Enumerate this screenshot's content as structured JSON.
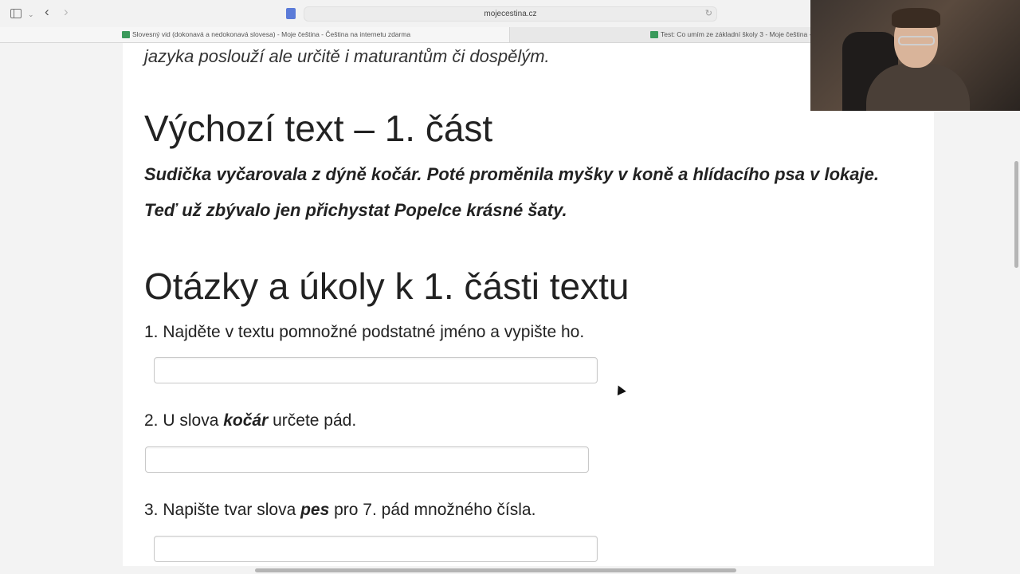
{
  "browser": {
    "url": "mojecestina.cz",
    "tabs": [
      {
        "title": "Slovesný vid (dokonavá a nedokonavá slovesa) - Moje čeština - Čeština na internetu zdarma",
        "active": true
      },
      {
        "title": "Test: Co umím ze základní školy 3 - Moje čeština - Češ",
        "active": false
      }
    ],
    "icons": {
      "sidebar": "sidebar-icon",
      "back": "‹",
      "forward": "›",
      "chevron": "⌄",
      "reload": "↻"
    }
  },
  "page": {
    "intro_tail": "jazyka poslouží ale určitě i maturantům či dospělým.",
    "heading_source": "Výchozí text – 1. část",
    "source_lines": [
      "Sudička vyčarovala z dýně kočár. Poté proměnila myšky v koně a hlídacího psa v lokaje.",
      "Teď už zbývalo jen přichystat Popelce krásné šaty."
    ],
    "heading_questions": "Otázky a úkoly k 1. části textu",
    "questions": [
      {
        "before": "1. Najděte v textu pomnožné podstatné jméno a vypište ho.",
        "bold": "",
        "after": "",
        "answer": ""
      },
      {
        "before": "2. U slova ",
        "bold": "kočár",
        "after": " určete pád.",
        "answer": ""
      },
      {
        "before": "3. Napište tvar slova ",
        "bold": "pes",
        "after": " pro 7. pád množného čísla.",
        "answer": ""
      }
    ]
  }
}
